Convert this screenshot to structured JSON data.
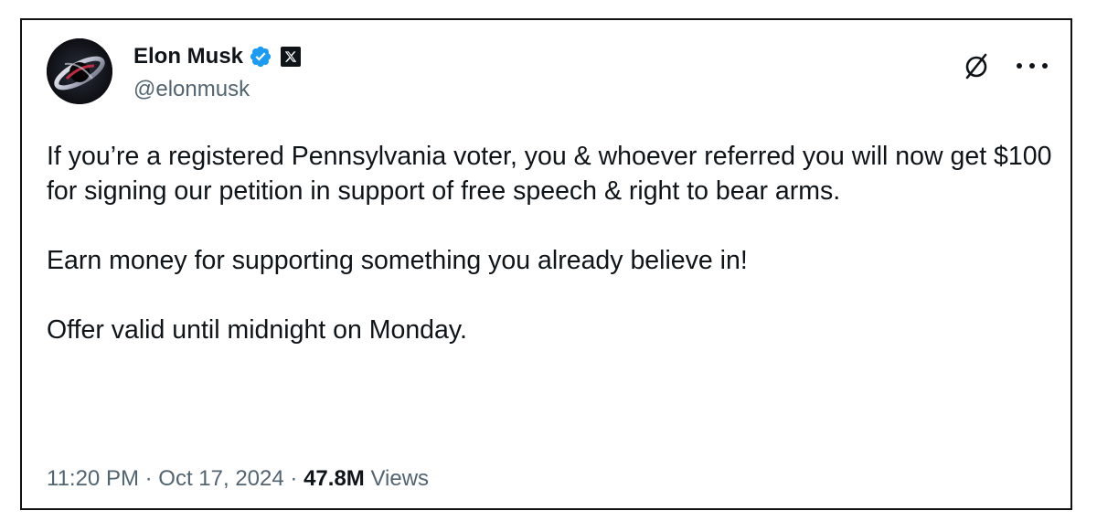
{
  "author": {
    "display_name": "Elon Musk",
    "handle": "@elonmusk",
    "avatar_icon": "black-hole-avatar",
    "verified_icon": "verified-badge-icon",
    "affiliate_icon": "x-logo-icon"
  },
  "tweet": {
    "paragraphs": [
      "If you’re a registered Pennsylvania voter, you & whoever referred you will now get $100 for signing our petition in support of free speech & right to bear arms.",
      "Earn money for supporting something you already believe in!",
      "Offer valid until midnight on Monday."
    ]
  },
  "meta": {
    "time": "11:20 PM",
    "separator": "·",
    "date": "Oct 17, 2024",
    "views_count": "47.8M",
    "views_label": "Views"
  },
  "actions": {
    "grok_icon": "grok-icon",
    "more_icon": "more-options-icon"
  },
  "colors": {
    "text_primary": "#0f1419",
    "text_secondary": "#536471",
    "verified_blue": "#1d9bf0",
    "border": "#111111"
  }
}
